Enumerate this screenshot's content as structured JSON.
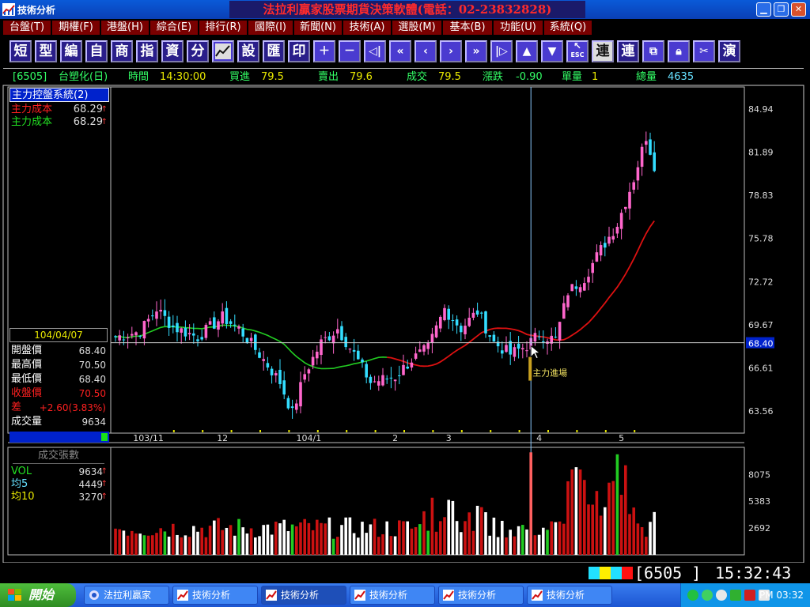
{
  "window": {
    "title": "技術分析",
    "brand": "法拉利贏家股票期貨決策軟體(電話：02-23832828)"
  },
  "menu": [
    {
      "label": "台盤(T)"
    },
    {
      "label": "期權(F)"
    },
    {
      "label": "港盤(H)"
    },
    {
      "label": "綜合(E)"
    },
    {
      "label": "排行(R)"
    },
    {
      "label": "國際(I)"
    },
    {
      "label": "新聞(N)"
    },
    {
      "label": "技術(A)"
    },
    {
      "label": "選股(M)"
    },
    {
      "label": "基本(B)"
    },
    {
      "label": "功能(U)"
    },
    {
      "label": "系統(Q)"
    }
  ],
  "toolbar": {
    "text_buttons": [
      "短",
      "型",
      "編",
      "自",
      "商",
      "指",
      "資",
      "分"
    ],
    "text_buttons_2": [
      "設",
      "匯",
      "印"
    ],
    "text_buttons_3": [
      "連",
      "連"
    ],
    "text_buttons_4": [
      "演"
    ],
    "esc_label": "ESC"
  },
  "quote": {
    "code": "[6505]",
    "name": "台塑化(日)",
    "time_label": "時間",
    "time": "14:30:00",
    "bid_label": "買進",
    "bid": "79.5",
    "ask_label": "賣出",
    "ask": "79.6",
    "deal_label": "成交",
    "deal": "79.5",
    "change_label": "漲跌",
    "change": "-0.90",
    "unit_label": "單量",
    "unit": "1",
    "total_label": "總量",
    "total": "4635"
  },
  "indicator": {
    "title": "主力控盤系統(2)",
    "rows": [
      {
        "label": "主力成本",
        "value": "68.29",
        "color": "#ff2020"
      },
      {
        "label": "主力成本",
        "value": "68.29",
        "color": "#22e022"
      }
    ]
  },
  "ohlc": {
    "date": "104/04/07",
    "rows": [
      {
        "label": "開盤價",
        "value": "68.40",
        "color": "#ffffff",
        "vcolor": "#dddddd"
      },
      {
        "label": "最高價",
        "value": "70.50",
        "color": "#ffffff",
        "vcolor": "#dddddd"
      },
      {
        "label": "最低價",
        "value": "68.40",
        "color": "#ffffff",
        "vcolor": "#dddddd"
      },
      {
        "label": "收盤價",
        "value": "70.50",
        "color": "#ff2020",
        "vcolor": "#ff2020"
      },
      {
        "label": "差",
        "value": "+2.60(3.83%)",
        "color": "#ff2020",
        "vcolor": "#ff2020"
      },
      {
        "label": "成交量",
        "value": "9634",
        "color": "#ffffff",
        "vcolor": "#dddddd"
      }
    ]
  },
  "volume_panel": {
    "title": "成交張數",
    "rows": [
      {
        "label": "VOL",
        "value": "9634",
        "color": "#22e022"
      },
      {
        "label": "均5",
        "value": "4449",
        "color": "#66e0ff"
      },
      {
        "label": "均10",
        "value": "3270",
        "color": "#e8e800"
      }
    ]
  },
  "annotation": "主力進場",
  "status": {
    "code": "[6505  ]",
    "time": "15:32:43"
  },
  "taskbar": {
    "start": "開始",
    "tasks": [
      "法拉利贏家",
      "技術分析",
      "技術分析",
      "技術分析",
      "技術分析",
      "技術分析"
    ],
    "clock": "PM 03:32"
  },
  "colors": {
    "up_candle": "#ff66cc",
    "down_candle": "#33ddff",
    "ma_red": "#dd1111",
    "ma_green": "#22cc22",
    "vol_up": "#cc1111",
    "vol_down": "#ffffff",
    "vol_green": "#22cc22"
  },
  "chart_data": {
    "type": "candlestick",
    "price_ticks": [
      84.94,
      81.89,
      78.83,
      75.78,
      72.72,
      69.67,
      66.61,
      63.56
    ],
    "price_range": [
      62.0,
      86.5
    ],
    "current_price": 68.4,
    "x_ticks": [
      {
        "label": "103/11",
        "index": 8
      },
      {
        "label": "12",
        "index": 26
      },
      {
        "label": "104/1",
        "index": 47
      },
      {
        "label": "2",
        "index": 68
      },
      {
        "label": "3",
        "index": 81
      },
      {
        "label": "4",
        "index": 103
      },
      {
        "label": "5",
        "index": 123
      }
    ],
    "cursor_index": 101,
    "volume_ticks": [
      8075,
      5383,
      2692
    ],
    "volume_range": [
      0,
      10800
    ]
  }
}
